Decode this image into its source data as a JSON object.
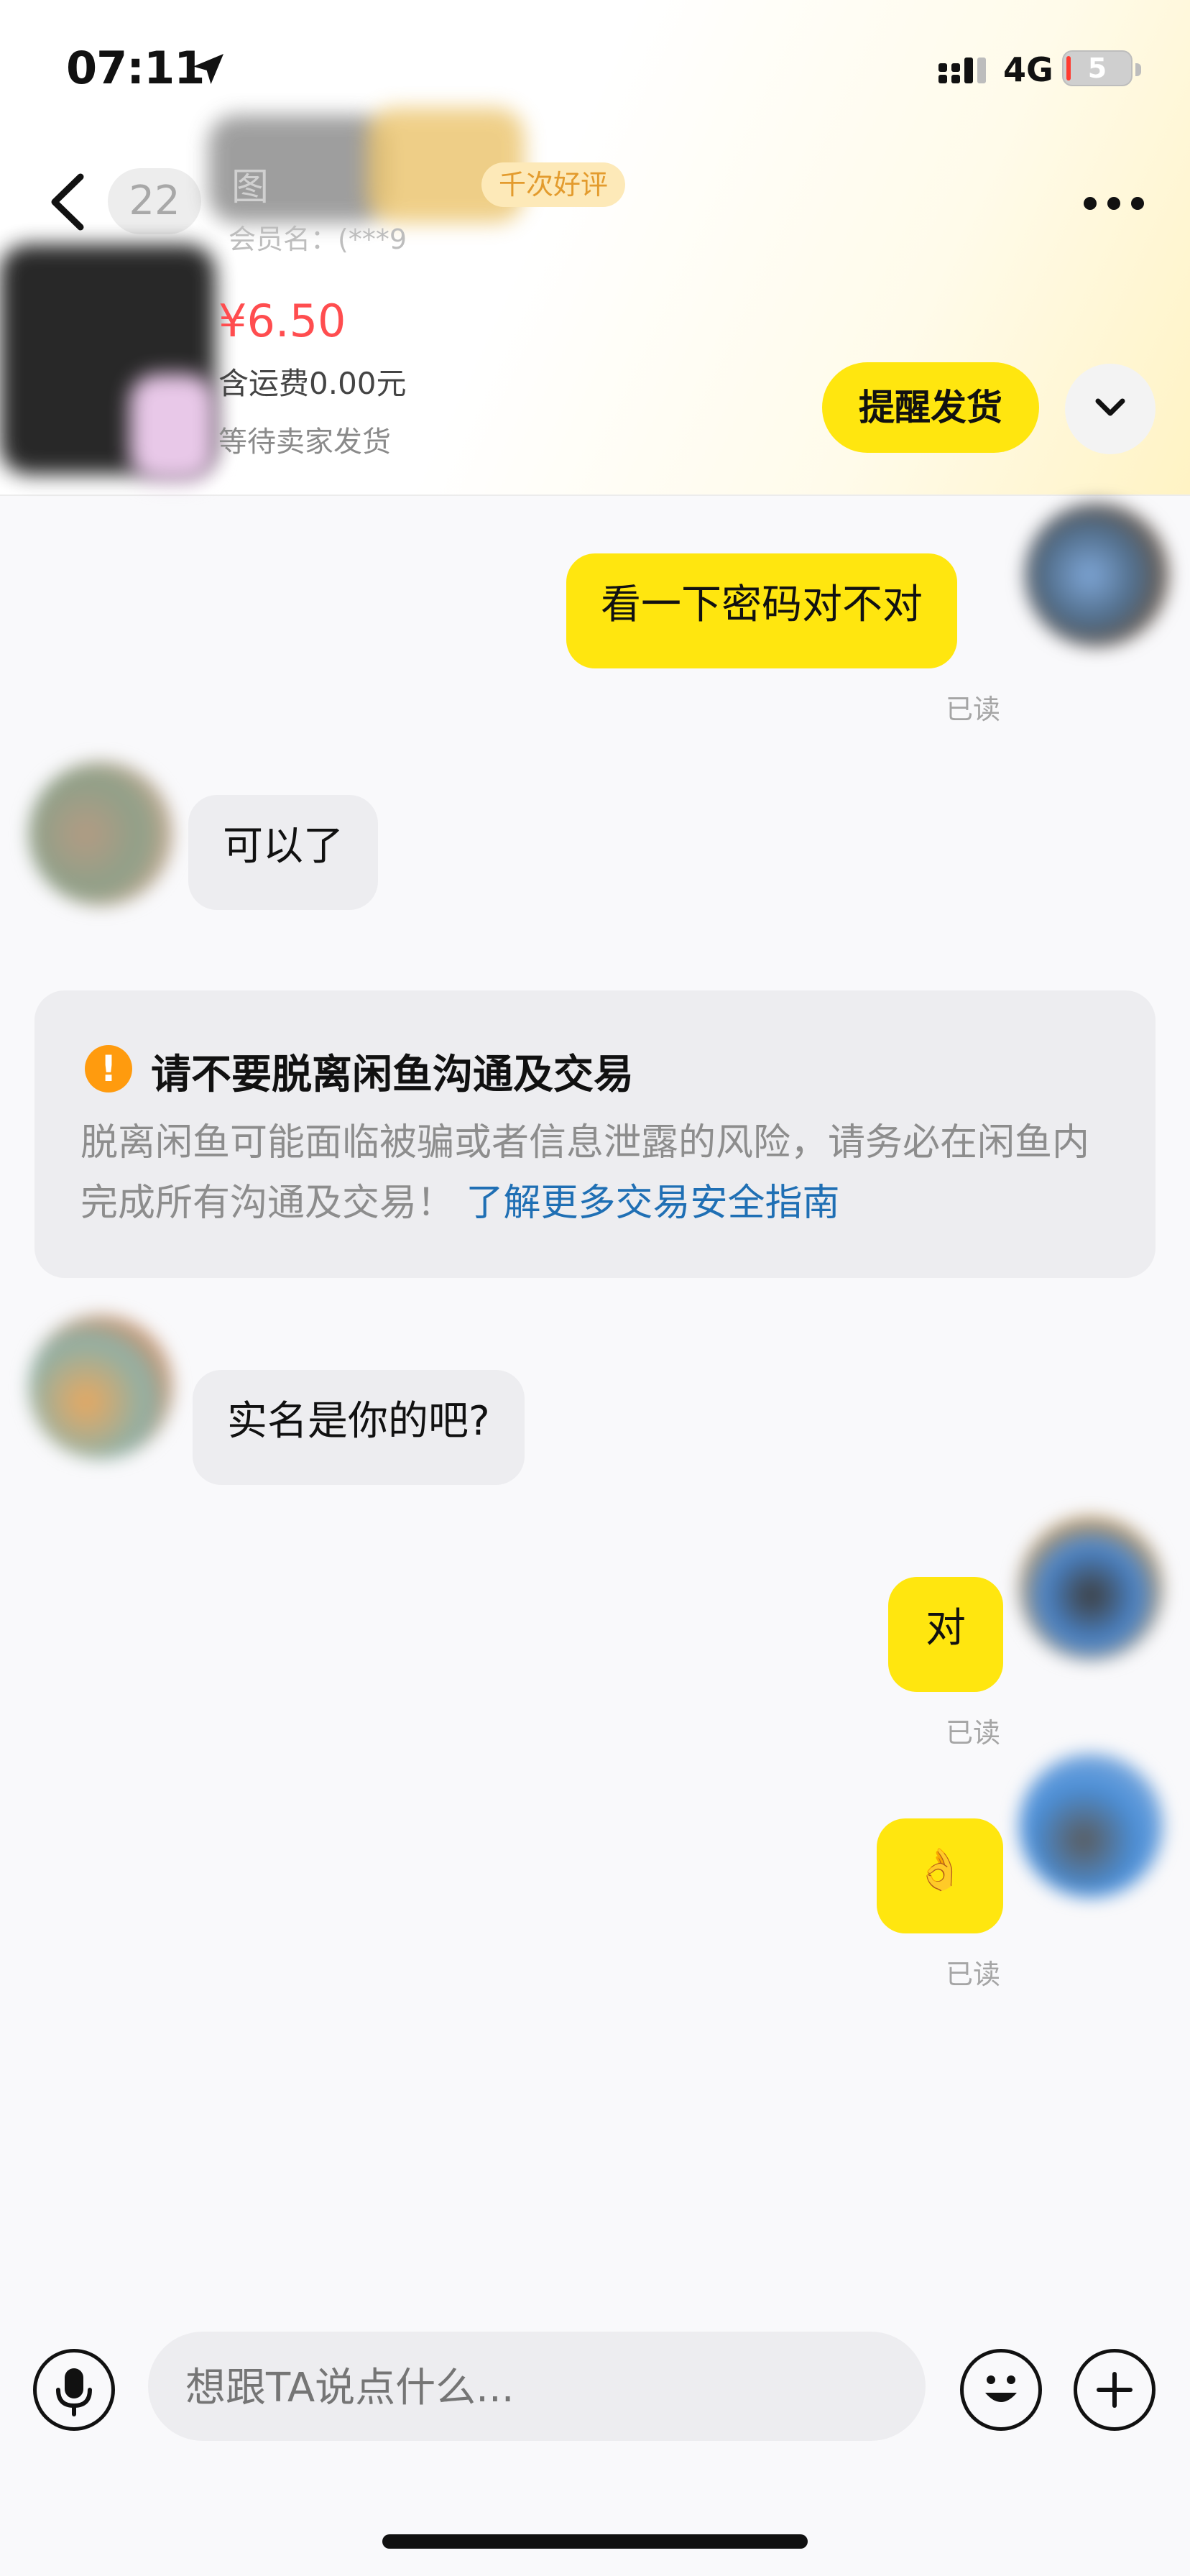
{
  "status_bar": {
    "time": "07:11",
    "network": "4G",
    "battery": "5"
  },
  "header": {
    "unread_count": "22",
    "seller_name_partial": "图",
    "member_label": "会员名：(***9",
    "rating_badge": "千次好评"
  },
  "order": {
    "price": "¥6.50",
    "shipping": "含运费0.00元",
    "status": "等待卖家发货",
    "remind_button": "提醒发货"
  },
  "messages": [
    {
      "from": "me",
      "text": "看一下密码对不对",
      "read": "已读"
    },
    {
      "from": "them",
      "text": "可以了"
    },
    {
      "from": "them",
      "text": "实名是你的吧?"
    },
    {
      "from": "me",
      "text": "对",
      "read": "已读"
    },
    {
      "from": "me",
      "text": "👌",
      "read": "已读"
    }
  ],
  "notice": {
    "icon": "!",
    "title": "请不要脱离闲鱼沟通及交易",
    "body": "脱离闲鱼可能面临被骗或者信息泄露的风险，请务必在闲鱼内完成所有沟通及交易！",
    "link": "了解更多交易安全指南"
  },
  "input": {
    "placeholder": "想跟TA说点什么..."
  },
  "colors": {
    "accent_yellow": "#ffe60f",
    "price_red": "#ff4d4f",
    "link_blue": "#1f6fb4",
    "warning_orange": "#ff9b0e"
  },
  "icons": [
    "back-icon",
    "location-arrow-icon",
    "signal-icon",
    "more-icon",
    "chevron-down-icon",
    "microphone-icon",
    "emoji-icon",
    "plus-icon"
  ]
}
